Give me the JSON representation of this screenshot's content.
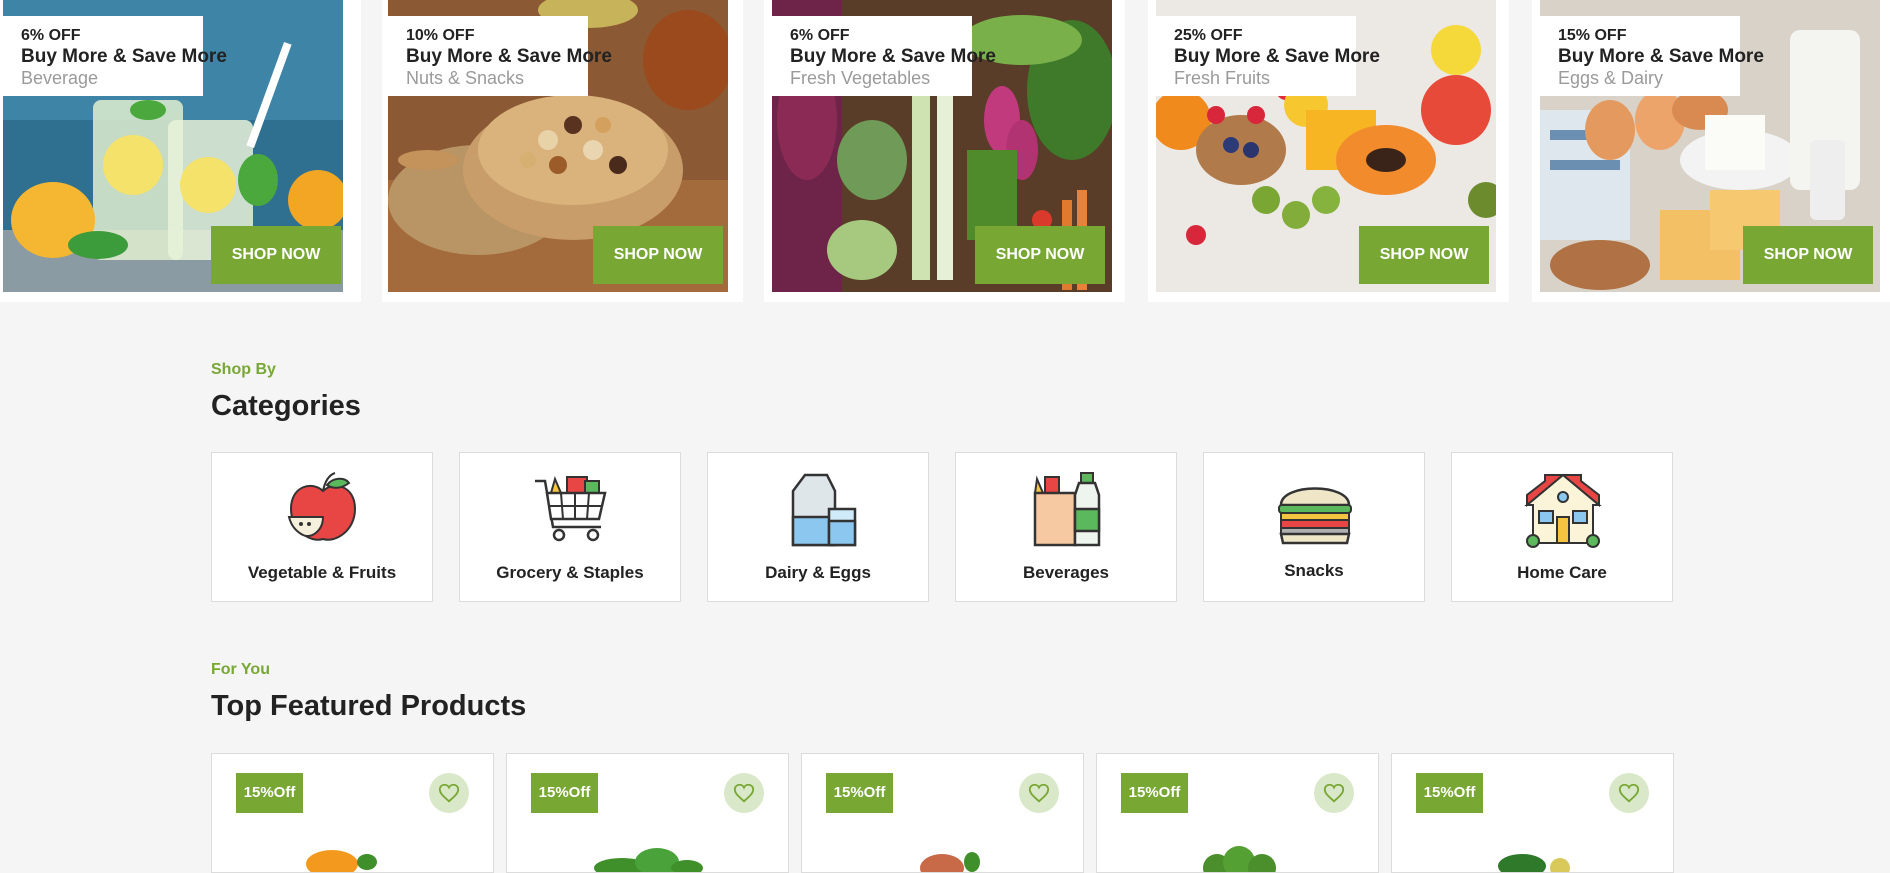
{
  "banners": [
    {
      "discount": "6% OFF",
      "headline": "Buy More & Save More",
      "category": "Beverage",
      "cta": "SHOP NOW"
    },
    {
      "discount": "10% OFF",
      "headline": "Buy More & Save More",
      "category": "Nuts & Snacks",
      "cta": "SHOP NOW"
    },
    {
      "discount": "6% OFF",
      "headline": "Buy More & Save More",
      "category": "Fresh Vegetables",
      "cta": "SHOP NOW"
    },
    {
      "discount": "25% OFF",
      "headline": "Buy More & Save More",
      "category": "Fresh Fruits",
      "cta": "SHOP NOW"
    },
    {
      "discount": "15% OFF",
      "headline": "Buy More & Save More",
      "category": "Eggs & Dairy",
      "cta": "SHOP NOW"
    }
  ],
  "categories_section": {
    "eyebrow": "Shop By",
    "title": "Categories",
    "items": [
      {
        "label": "Vegetable & Fruits",
        "icon": "apple-icon"
      },
      {
        "label": "Grocery & Staples",
        "icon": "shopping-cart-icon"
      },
      {
        "label": "Dairy & Eggs",
        "icon": "milk-carton-icon"
      },
      {
        "label": "Beverages",
        "icon": "beverage-bottle-icon"
      },
      {
        "label": "Snacks",
        "icon": "burger-icon"
      },
      {
        "label": "Home Care",
        "icon": "house-icon"
      }
    ]
  },
  "featured_section": {
    "eyebrow": "For You",
    "title": "Top Featured Products",
    "products": [
      {
        "badge": "15%Off"
      },
      {
        "badge": "15%Off"
      },
      {
        "badge": "15%Off"
      },
      {
        "badge": "15%Off"
      },
      {
        "badge": "15%Off"
      }
    ]
  },
  "colors": {
    "accent": "#78a734",
    "background": "#f5f5f5",
    "muted_text": "#9a9a9a",
    "wishlist_bg": "#d9e8c8"
  }
}
